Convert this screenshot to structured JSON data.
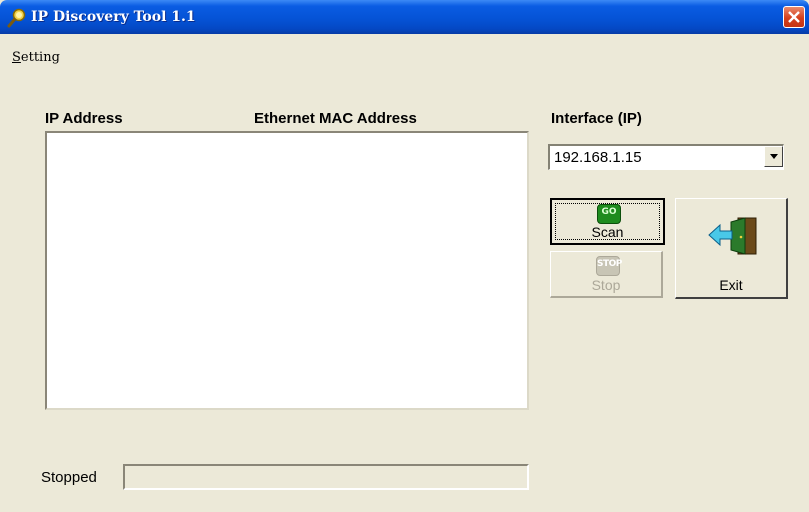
{
  "window": {
    "title": "IP Discovery Tool 1.1",
    "app_icon": "magnifier-icon",
    "close_icon": "close-icon"
  },
  "menu": {
    "items": [
      {
        "label": "Setting"
      }
    ]
  },
  "device_list": {
    "columns": [
      "IP Address",
      "Ethernet MAC Address"
    ],
    "rows": []
  },
  "interface": {
    "label": "Interface (IP)",
    "selected": "192.168.1.15"
  },
  "buttons": {
    "scan": {
      "label": "Scan",
      "icon": "go-icon",
      "icon_text": "GO"
    },
    "stop": {
      "label": "Stop",
      "icon": "stop-icon",
      "icon_text": "STOP",
      "enabled": false
    },
    "exit": {
      "label": "Exit",
      "icon": "exit-door-icon"
    }
  },
  "status": {
    "text": "Stopped",
    "progress": 0
  },
  "colors": {
    "titlebar": "#0553d6",
    "window_bg": "#ece9d8",
    "close_button": "#d5401d",
    "go_icon": "#1e8c1e"
  }
}
